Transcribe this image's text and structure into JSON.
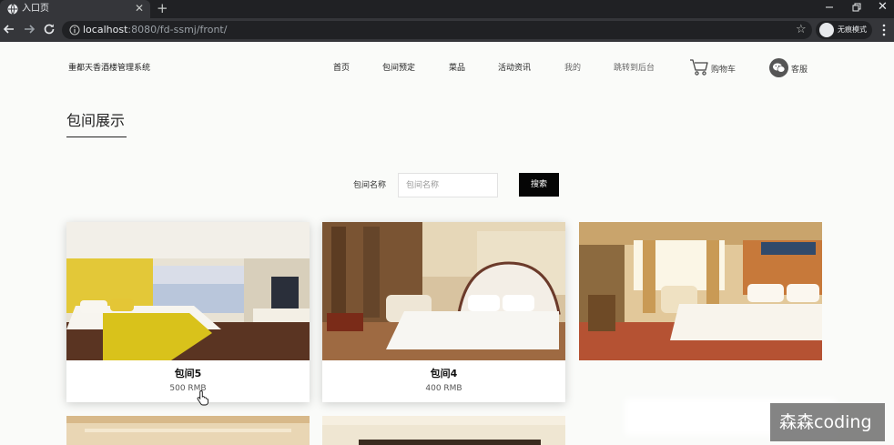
{
  "browser": {
    "tab_title": "入口页",
    "new_tab": "+",
    "url_host": "localhost",
    "url_rest": ":8080/fd-ssmj/front/",
    "incognito_label": "无痕模式",
    "icons": [
      "globe-icon",
      "close-icon",
      "back-arrow-icon",
      "forward-arrow-icon",
      "reload-icon",
      "info-icon",
      "star-icon",
      "incognito-icon",
      "menu-dots-icon"
    ]
  },
  "header": {
    "site_name": "重都天香酒楼管理系统",
    "nav": [
      "首页",
      "包间预定",
      "菜品",
      "活动资讯",
      "我的",
      "跳转到后台"
    ],
    "cart_label": "购物车",
    "service_label": "客服"
  },
  "section": {
    "title": "包间展示"
  },
  "search": {
    "label": "包间名称",
    "placeholder": "包间名称",
    "value": "",
    "button_label": "搜索"
  },
  "rooms": [
    {
      "name": "包间5",
      "price": "500 RMB"
    },
    {
      "name": "包间4",
      "price": "400 RMB"
    }
  ],
  "watermark": "森森coding",
  "colors": {
    "page_bg": "#fafbf9",
    "button_bg": "#050505",
    "chrome_dark": "#202124",
    "chrome_mid": "#35363a"
  }
}
